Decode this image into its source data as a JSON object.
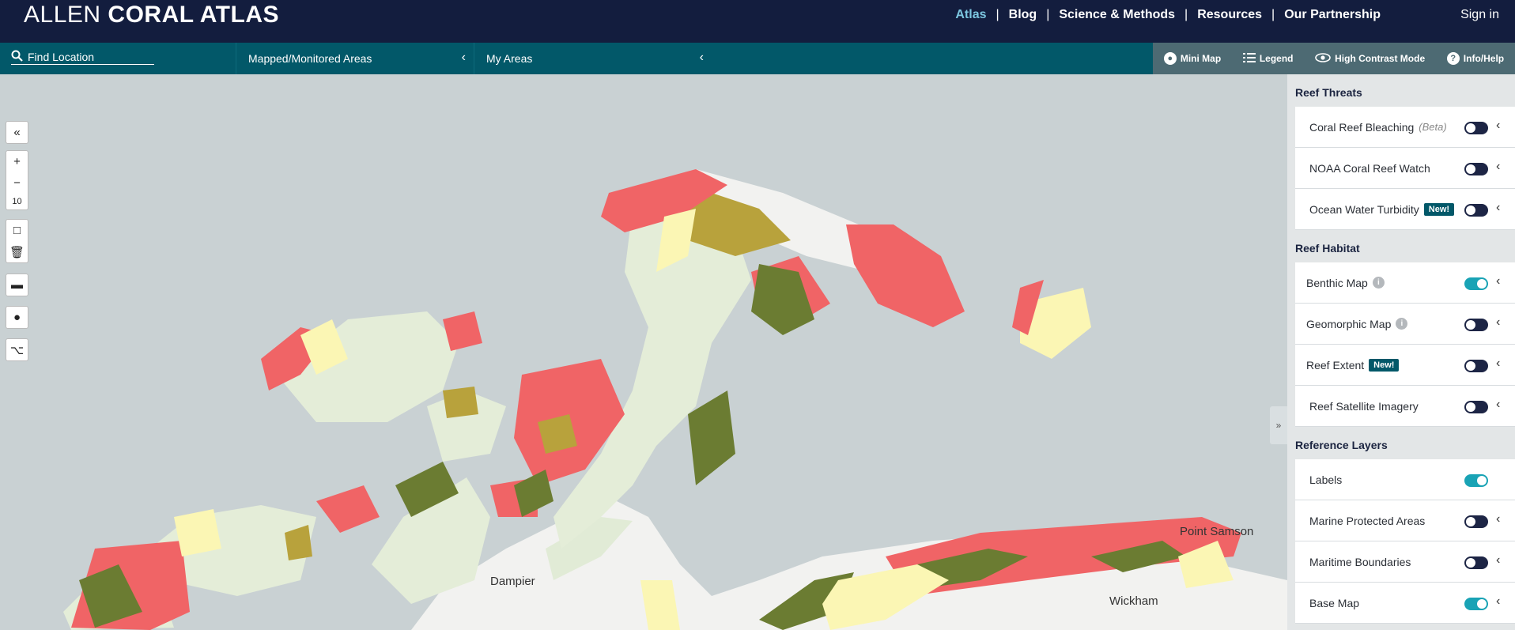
{
  "header": {
    "brand_light": "ALLEN",
    "brand_bold": "CORAL ATLAS",
    "nav": [
      "Atlas",
      "Blog",
      "Science & Methods",
      "Resources",
      "Our Partnership"
    ],
    "signin": "Sign in"
  },
  "toolbar": {
    "find_location": "Find Location",
    "mapped_areas": "Mapped/Monitored Areas",
    "my_areas": "My Areas",
    "tools": [
      "Mini Map",
      "Legend",
      "High Contrast Mode",
      "Info/Help"
    ]
  },
  "map": {
    "zoom": "10",
    "labels": [
      "Dampier",
      "Point Samson",
      "Wickham"
    ],
    "colors": {
      "water": "#c9d1d3",
      "land": "#f2f2f0",
      "sand": "#fbf6b4",
      "seagrass": "#6b7c32",
      "rubble": "#b8a23c",
      "coral": "#f06466",
      "island": "#e4edd8"
    }
  },
  "panel": {
    "sections": [
      {
        "title": "Reef Threats",
        "rows": [
          {
            "label": "Coral Reef Bleaching",
            "note": "(Beta)",
            "on": false,
            "chevron": true
          },
          {
            "label": "NOAA Coral Reef Watch",
            "on": false,
            "chevron": true
          },
          {
            "label": "Ocean Water Turbidity",
            "badge": "New!",
            "on": false,
            "chevron": true
          }
        ]
      },
      {
        "title": "Reef Habitat",
        "rows": [
          {
            "label": "Benthic Map",
            "info": true,
            "on": true,
            "chevron": true
          },
          {
            "label": "Geomorphic Map",
            "info": true,
            "on": false,
            "chevron": true
          },
          {
            "label": "Reef Extent",
            "badge": "New!",
            "on": false,
            "chevron": true
          },
          {
            "label": "Reef Satellite Imagery",
            "on": false,
            "chevron": true
          }
        ]
      },
      {
        "title": "Reference Layers",
        "rows": [
          {
            "label": "Labels",
            "on": true,
            "chevron": false
          },
          {
            "label": "Marine Protected Areas",
            "on": false,
            "chevron": true
          },
          {
            "label": "Maritime Boundaries",
            "on": false,
            "chevron": true
          },
          {
            "label": "Base Map",
            "on": true,
            "chevron": true
          }
        ]
      }
    ],
    "info_glyph": "i"
  }
}
